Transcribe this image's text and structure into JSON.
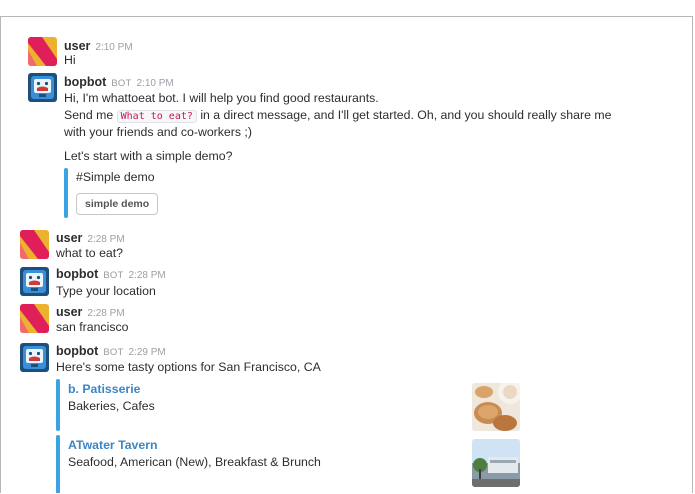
{
  "messages": [
    {
      "name": "user",
      "time": "2:10 PM",
      "lines": [
        "Hi"
      ]
    },
    {
      "name": "bopbot",
      "bot_tag": "BOT",
      "time": "2:10 PM",
      "line1": "Hi, I'm whattoeat bot. I will help you find good restaurants.",
      "line2_before": "Send me",
      "line2_code": "What to eat?",
      "line2_after": "in a direct message, and I'll get started. Oh, and you should really share me",
      "line3": "with your friends and co-workers ;)",
      "line4": "Let's start with a simple demo?",
      "attachment": {
        "text": "#Simple demo",
        "button": "simple demo"
      }
    },
    {
      "name": "user",
      "time": "2:28 PM",
      "lines": [
        "what to eat?"
      ]
    },
    {
      "name": "bopbot",
      "bot_tag": "BOT",
      "time": "2:28 PM",
      "lines": [
        "Type your location"
      ]
    },
    {
      "name": "user",
      "time": "2:28 PM",
      "lines": [
        "san francisco"
      ]
    },
    {
      "name": "bopbot",
      "bot_tag": "BOT",
      "time": "2:29 PM",
      "lines": [
        "Here's some tasty options for San Francisco, CA"
      ],
      "results": [
        {
          "title": "b. Patisserie",
          "subtitle": "Bakeries, Cafes"
        },
        {
          "title": "ATwater Tavern",
          "subtitle": "Seafood, American (New), Breakfast & Brunch"
        }
      ]
    }
  ],
  "colors": {
    "accent": "#3aa3e3",
    "link": "#3b86c4",
    "user_avatar_red": "#e01e5a",
    "user_avatar_yellow": "#ecb22e",
    "bot_avatar_blue": "#3b8fd9"
  },
  "icons": {
    "user_avatar": "user-avatar-icon",
    "bot_avatar": "robot-avatar-icon"
  }
}
